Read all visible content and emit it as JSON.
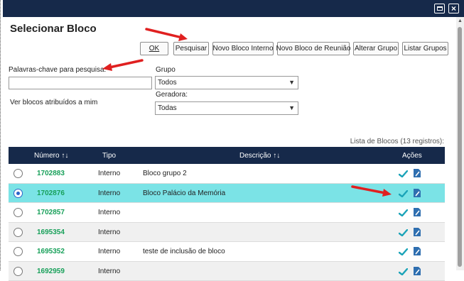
{
  "window": {
    "maximize_icon": "maximize-icon",
    "close_label": "×"
  },
  "page": {
    "title": "Selecionar Bloco"
  },
  "toolbar": {
    "ok": "OK",
    "search": "Pesquisar",
    "new_internal": "Novo Bloco Interno",
    "new_meeting": "Novo Bloco de Reunião",
    "alter_group": "Alterar Grupo",
    "list_groups": "Listar Grupos"
  },
  "filters": {
    "keywords_label": "Palavras-chave para pesquisa:",
    "keywords_value": "",
    "assigned_label": "Ver blocos atribuídos a mim",
    "group_label": "Grupo",
    "group_value": "Todos",
    "generator_label": "Geradora:",
    "generator_value": "Todas"
  },
  "table": {
    "caption": "Lista de Blocos (13 registros):",
    "headers": {
      "number": "Número",
      "type": "Tipo",
      "description": "Descrição",
      "actions": "Ações"
    },
    "rows": [
      {
        "number": "1702883",
        "type": "Interno",
        "description": "Bloco grupo 2",
        "selected": false
      },
      {
        "number": "1702876",
        "type": "Interno",
        "description": "Bloco Palácio da Memória",
        "selected": true
      },
      {
        "number": "1702857",
        "type": "Interno",
        "description": "",
        "selected": false
      },
      {
        "number": "1695354",
        "type": "Interno",
        "description": "",
        "selected": false
      },
      {
        "number": "1695352",
        "type": "Interno",
        "description": "teste de inclusão de bloco",
        "selected": false
      },
      {
        "number": "1692959",
        "type": "Interno",
        "description": "",
        "selected": false
      }
    ]
  },
  "colors": {
    "titlebar": "#16294a",
    "selected_row": "#7be3e6",
    "number_link": "#18a05a",
    "annotation_arrow": "#e02020"
  }
}
